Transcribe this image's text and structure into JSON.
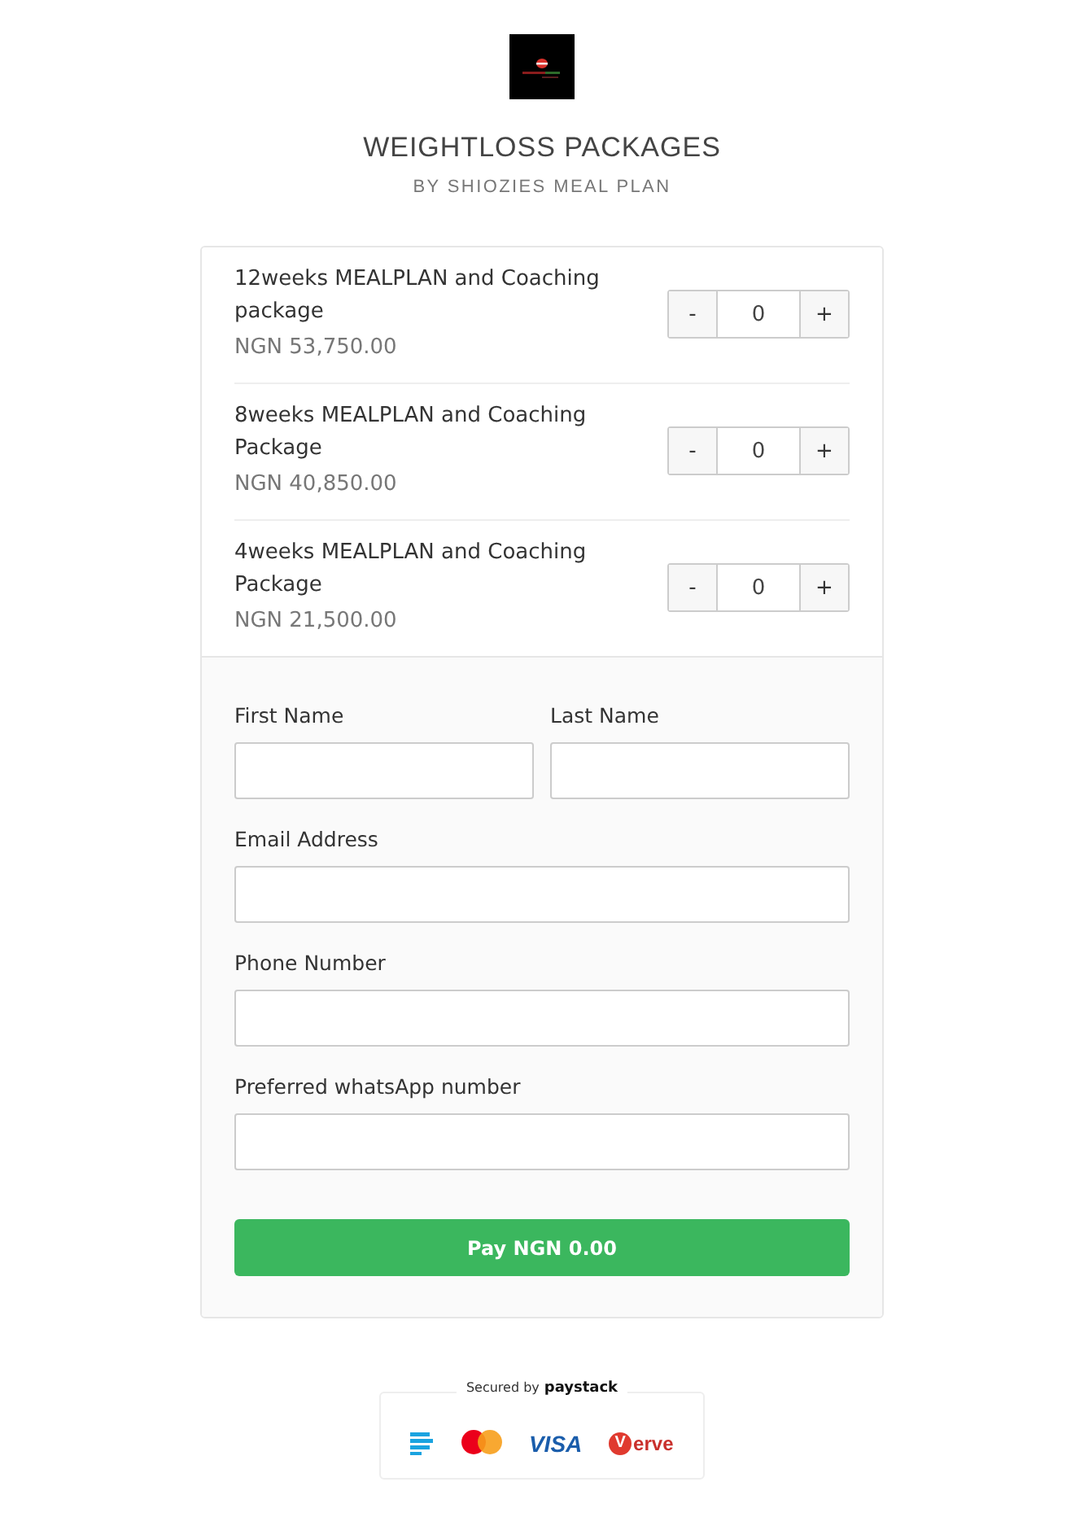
{
  "header": {
    "title": "WEIGHTLOSS PACKAGES",
    "subtitle": "BY SHIOZIES MEAL PLAN"
  },
  "products": [
    {
      "name": "12weeks MEALPLAN and Coaching package",
      "price": "NGN 53,750.00",
      "decrement": "-",
      "quantity": "0",
      "increment": "+"
    },
    {
      "name": "8weeks MEALPLAN and Coaching Package",
      "price": "NGN 40,850.00",
      "decrement": "-",
      "quantity": "0",
      "increment": "+"
    },
    {
      "name": "4weeks MEALPLAN and Coaching Package",
      "price": "NGN 21,500.00",
      "decrement": "-",
      "quantity": "0",
      "increment": "+"
    }
  ],
  "form": {
    "name_fields": [
      {
        "label": "First Name"
      },
      {
        "label": "Last Name"
      }
    ],
    "fields": [
      {
        "label": "Email Address"
      },
      {
        "label": "Phone Number"
      },
      {
        "label": "Preferred whatsApp number"
      }
    ],
    "pay_button": "Pay NGN 0.00"
  },
  "footer": {
    "secured_by": "Secured by",
    "brand": "paystack",
    "cards": [
      {
        "kind": "bank"
      },
      {
        "kind": "mastercard"
      },
      {
        "kind": "visa",
        "label": "VISA"
      },
      {
        "kind": "verve",
        "label": "erve",
        "initial": "V"
      }
    ]
  }
}
